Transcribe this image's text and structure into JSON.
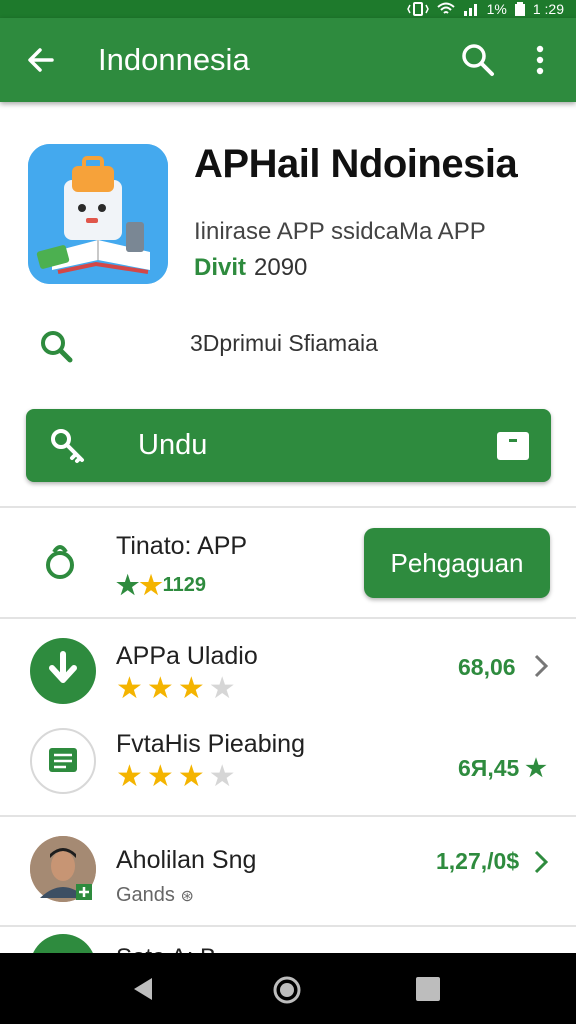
{
  "status_bar": {
    "battery_text": "1%",
    "time": "1 :29"
  },
  "app_bar": {
    "title": "Indonnesia"
  },
  "app": {
    "name": "APHail Ndoinesia",
    "subtitle": "Iinirase APP ssidcaMa APP",
    "developer_label": "Divit",
    "developer_value": "2090"
  },
  "search_row": {
    "text": "3Dprimui Sfiamaia"
  },
  "install_button": {
    "label": "Undu"
  },
  "thanks_row": {
    "title": "Tinato: APP",
    "rating_text": "1129",
    "button_label": "Pehgaguan"
  },
  "list": [
    {
      "name": "APPa Uladio",
      "value": "68,06",
      "stars": 3
    },
    {
      "name": "FvtaHis Pieabing",
      "value": "6Я,45",
      "stars": 3
    },
    {
      "name": "Aholilan Sng",
      "subtitle": "Gands",
      "value": "1,27,/0$"
    }
  ],
  "peek_row": {
    "text": "Sota A: B"
  },
  "colors": {
    "primary_green": "#2e8b3e",
    "status_green": "#1e7a2c",
    "star_yellow": "#f4b400",
    "star_empty": "#d6d6d6"
  }
}
